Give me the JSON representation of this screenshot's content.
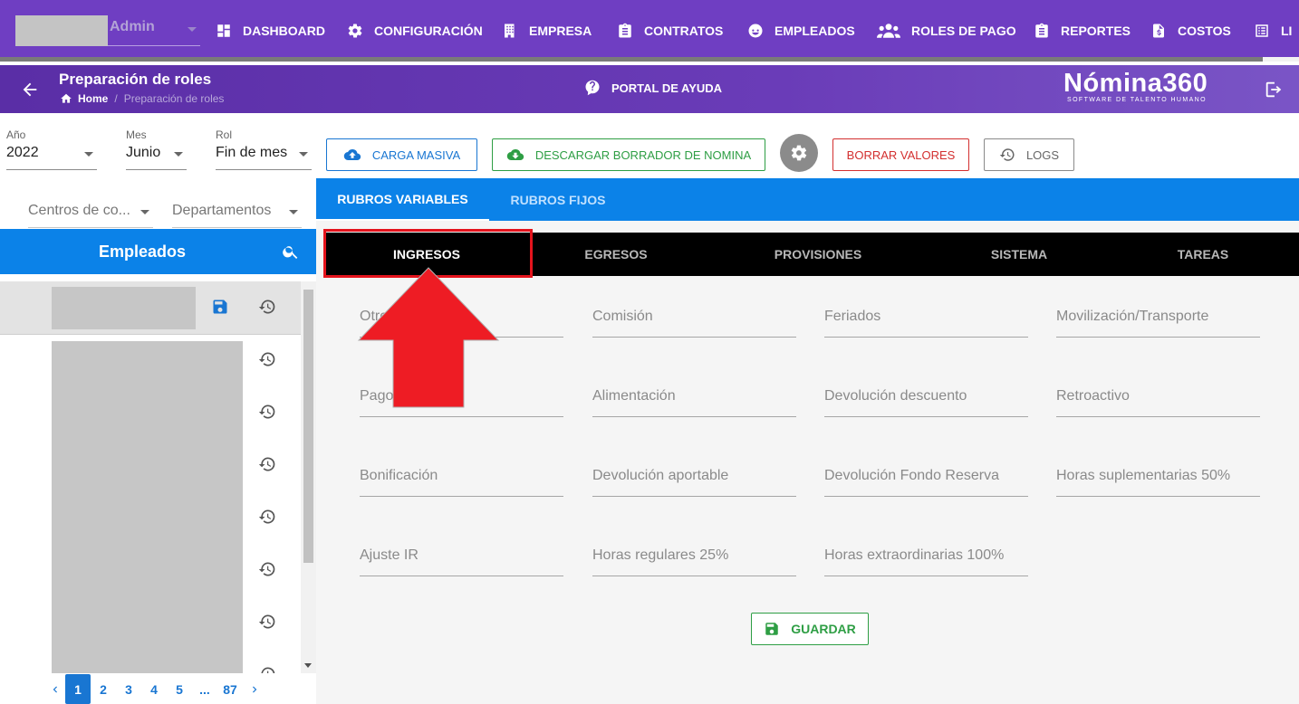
{
  "topnav": {
    "user": "Admin",
    "items": [
      {
        "label": "DASHBOARD",
        "icon": "dashboard-icon"
      },
      {
        "label": "CONFIGURACIÓN",
        "icon": "gear-icon"
      },
      {
        "label": "EMPRESA",
        "icon": "building-icon"
      },
      {
        "label": "CONTRATOS",
        "icon": "clipboard-icon"
      },
      {
        "label": "EMPLEADOS",
        "icon": "face-icon"
      },
      {
        "label": "ROLES DE PAGO",
        "icon": "people-icon"
      },
      {
        "label": "REPORTES",
        "icon": "report-icon"
      },
      {
        "label": "COSTOS",
        "icon": "invoice-icon"
      },
      {
        "label": "LI",
        "icon": "list-icon"
      }
    ]
  },
  "header": {
    "title": "Preparación de roles",
    "breadcrumb_home": "Home",
    "breadcrumb_sep": "/",
    "breadcrumb_current": "Preparación de roles",
    "help": "PORTAL DE AYUDA",
    "brand": "Nómina360",
    "brand_tagline": "SOFTWARE DE TALENTO HUMANO"
  },
  "filters": {
    "year_label": "Año",
    "year_value": "2022",
    "month_label": "Mes",
    "month_value": "Junio",
    "rol_label": "Rol",
    "rol_value": "Fin de mes",
    "centros": "Centros de co...",
    "departamentos": "Departamentos"
  },
  "actions": {
    "carga_masiva": "CARGA MASIVA",
    "descargar": "DESCARGAR BORRADOR DE NOMINA",
    "borrar": "BORRAR VALORES",
    "logs": "LOGS"
  },
  "employees": {
    "title": "Empleados",
    "pages": [
      "1",
      "2",
      "3",
      "4",
      "5",
      "...",
      "87"
    ],
    "current_page": "1"
  },
  "tabs": [
    "RUBROS VARIABLES",
    "RUBROS FIJOS"
  ],
  "subtabs": [
    "INGRESOS",
    "EGRESOS",
    "PROVISIONES",
    "SISTEMA",
    "TAREAS"
  ],
  "fields": [
    "Otros",
    "Comisión",
    "Feriados",
    "Movilización/Transporte",
    "Pagos",
    "Alimentación",
    "Devolución descuento",
    "Retroactivo",
    "Bonificación",
    "Devolución aportable",
    "Devolución Fondo Reserva",
    "Horas suplementarias 50%",
    "Ajuste IR",
    "Horas regulares 25%",
    "Horas extraordinarias 100%"
  ],
  "save_label": "GUARDAR",
  "colors": {
    "nav": "#6f3ec2",
    "primary_blue": "#0b82e8",
    "green": "#2e9e44",
    "red": "#d32f2f",
    "highlight_red": "#e4141d"
  }
}
